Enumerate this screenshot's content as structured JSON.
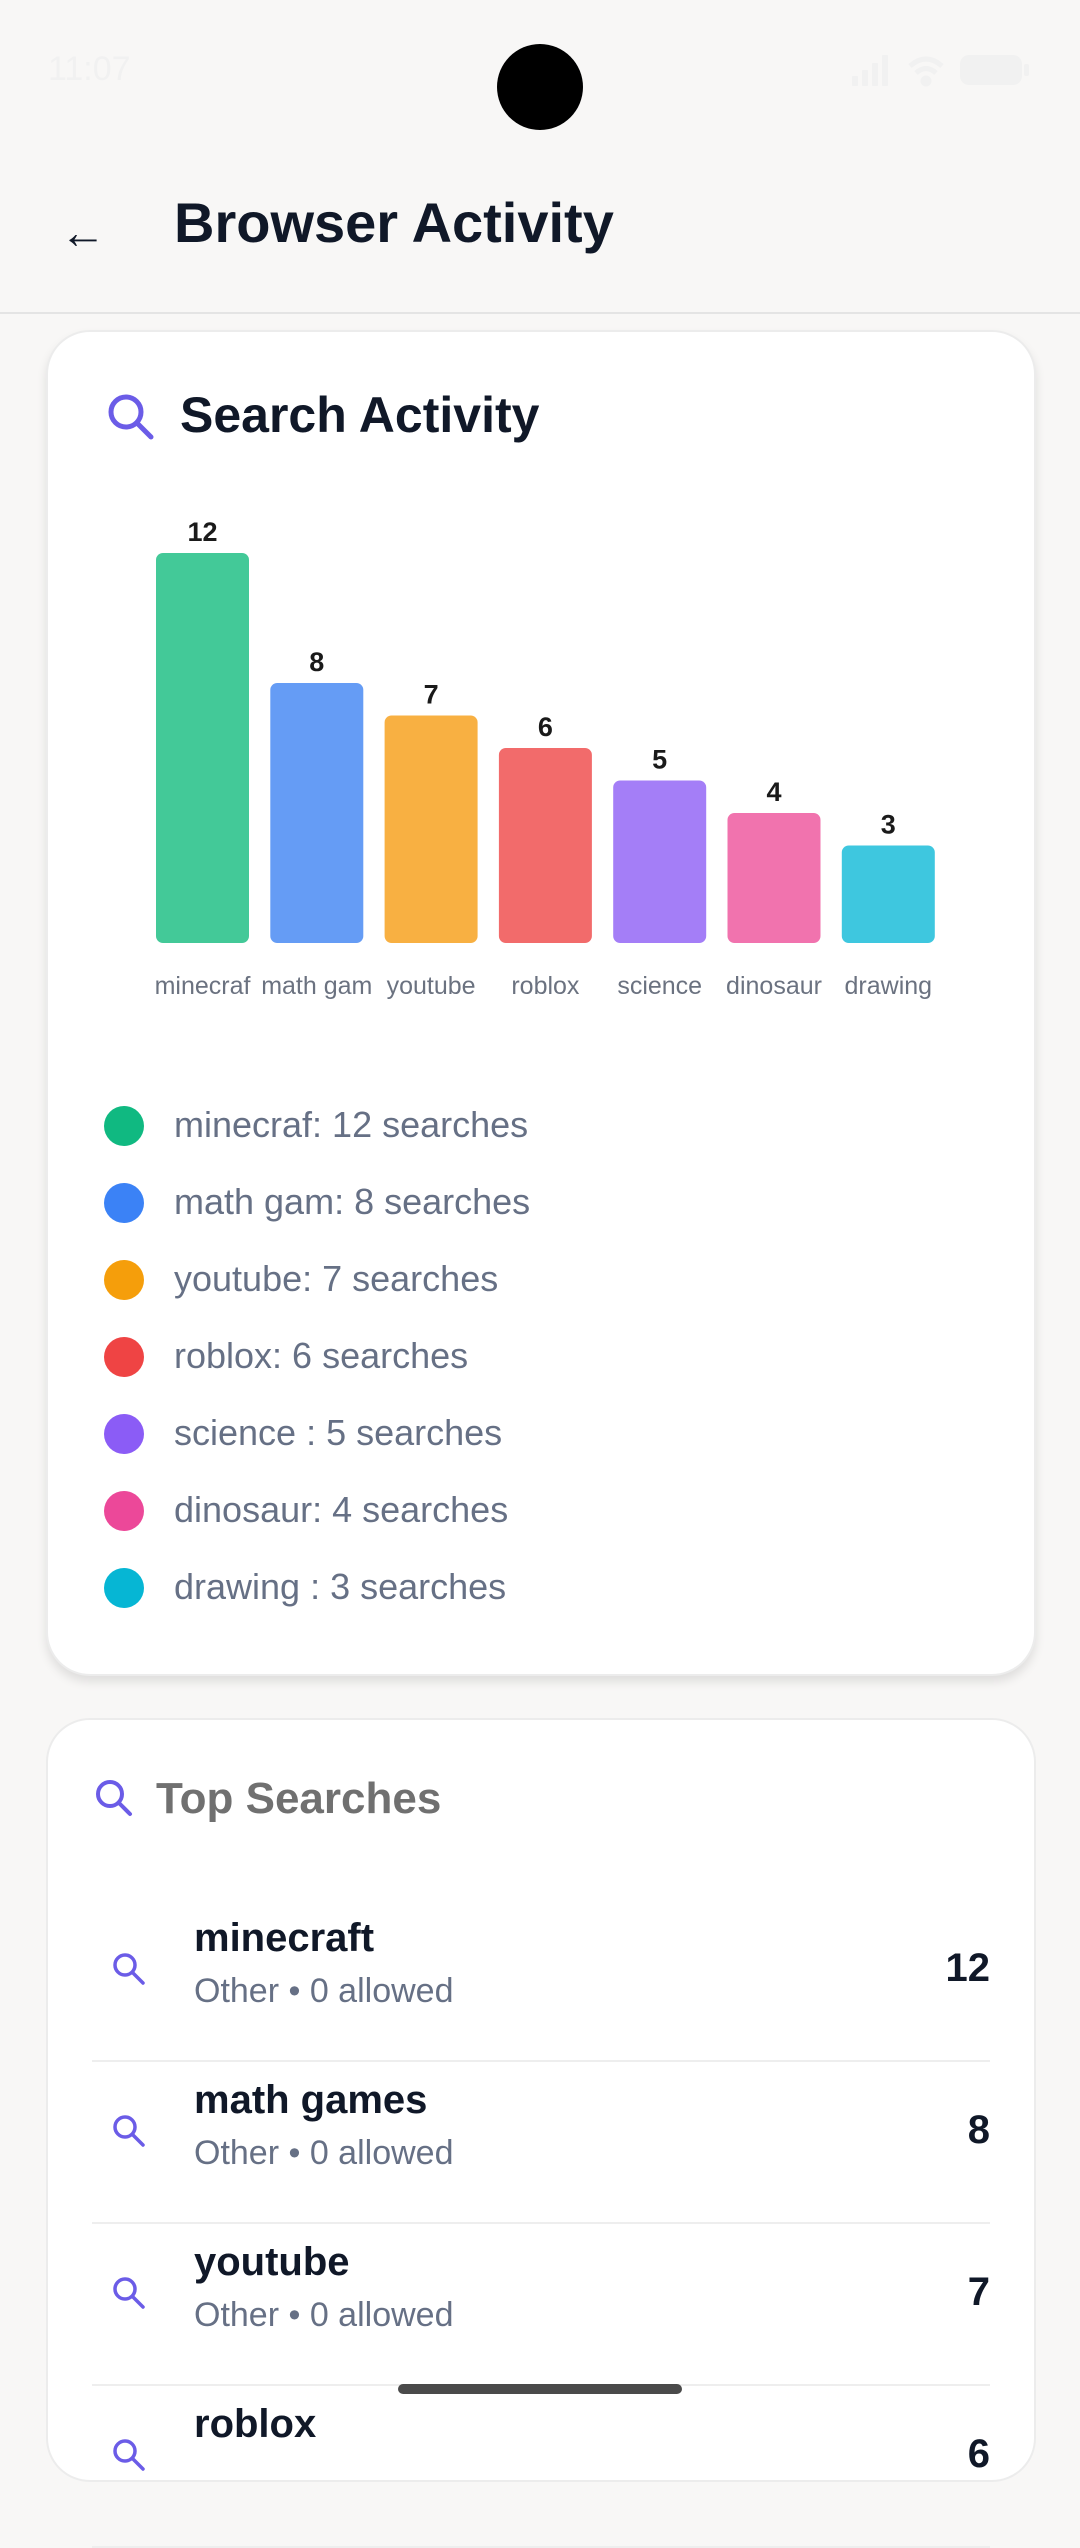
{
  "status_bar": {
    "time": "11:07"
  },
  "header": {
    "back_icon": "arrow-left-icon",
    "title": "Browser Activity"
  },
  "search_activity": {
    "title": "Search Activity",
    "icon": "search-icon",
    "legend": [
      {
        "text": "minecraf: 12 searches",
        "color": "#10b981"
      },
      {
        "text": "math gam: 8 searches",
        "color": "#3b82f6"
      },
      {
        "text": "youtube: 7 searches",
        "color": "#f59e0b"
      },
      {
        "text": "roblox: 6 searches",
        "color": "#ef4444"
      },
      {
        "text": "science : 5 searches",
        "color": "#8b5cf6"
      },
      {
        "text": "dinosaur: 4 searches",
        "color": "#ec4899"
      },
      {
        "text": "drawing : 3 searches",
        "color": "#06b6d4"
      }
    ]
  },
  "chart_data": {
    "type": "bar",
    "categories": [
      "minecraf",
      "math gam",
      "youtube",
      "roblox",
      "science",
      "dinosaur",
      "drawing"
    ],
    "values": [
      12,
      8,
      7,
      6,
      5,
      4,
      3
    ],
    "colors": [
      "#43c998",
      "#659cf5",
      "#f8b042",
      "#f26b6b",
      "#a47ef7",
      "#f173ae",
      "#3ec7df"
    ],
    "ylim": [
      0,
      12
    ],
    "data_labels": true,
    "grid": false,
    "legend": "below"
  },
  "top_searches": {
    "title": "Top Searches",
    "icon": "search-icon",
    "items": [
      {
        "term": "minecraft",
        "meta": "Other • 0 allowed",
        "count": "12"
      },
      {
        "term": "math games",
        "meta": "Other • 0 allowed",
        "count": "8"
      },
      {
        "term": "youtube",
        "meta": "Other • 0 allowed",
        "count": "7"
      },
      {
        "term": "roblox",
        "meta": "",
        "count": "6"
      }
    ]
  }
}
